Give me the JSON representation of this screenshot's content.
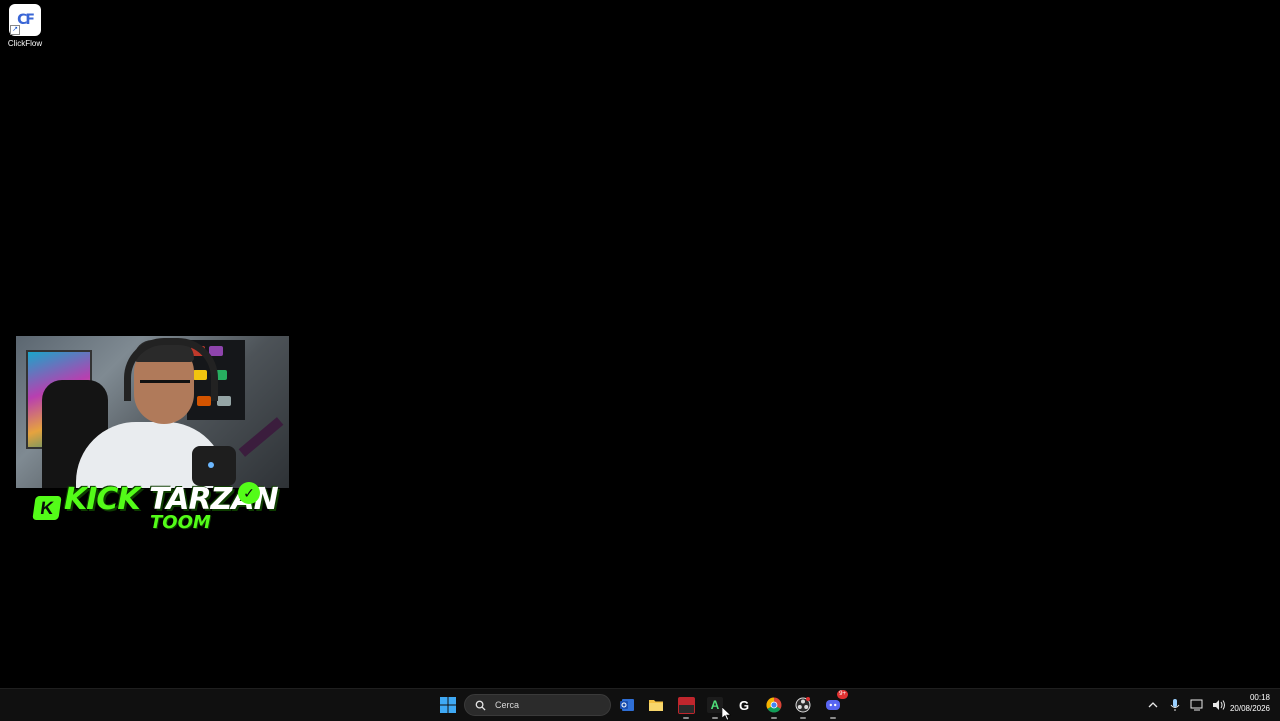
{
  "desktop": {
    "icons": [
      {
        "label": "ClickFlow",
        "glyph": "CF"
      }
    ]
  },
  "overlay": {
    "banner_title_green": "KICK",
    "banner_title_white": "TARZAN",
    "banner_sub": "TOOM",
    "banner_k": "K",
    "badge_glyph": "✓"
  },
  "taskbar": {
    "search_placeholder": "Cerca",
    "apps": [
      {
        "name": "outlook",
        "icon": "mail-icon"
      },
      {
        "name": "file-explorer",
        "icon": "folder-icon"
      },
      {
        "name": "voicemeeter",
        "icon": "voicemeeter-icon",
        "text": "VOICE\nMEETER"
      },
      {
        "name": "cursor-app",
        "icon": "a-icon",
        "text": "A"
      },
      {
        "name": "logitech",
        "icon": "g-icon",
        "text": "G"
      },
      {
        "name": "chrome",
        "icon": "chrome-icon"
      },
      {
        "name": "obs",
        "icon": "obs-icon"
      },
      {
        "name": "discord",
        "icon": "discord-icon",
        "badge": "9+"
      }
    ],
    "clock": {
      "time": "00:18",
      "date": "20/08/2026"
    }
  },
  "colors": {
    "kick_green": "#53fc18",
    "taskbar_bg": "#101010",
    "windows_blue": "#3fa9f5"
  }
}
